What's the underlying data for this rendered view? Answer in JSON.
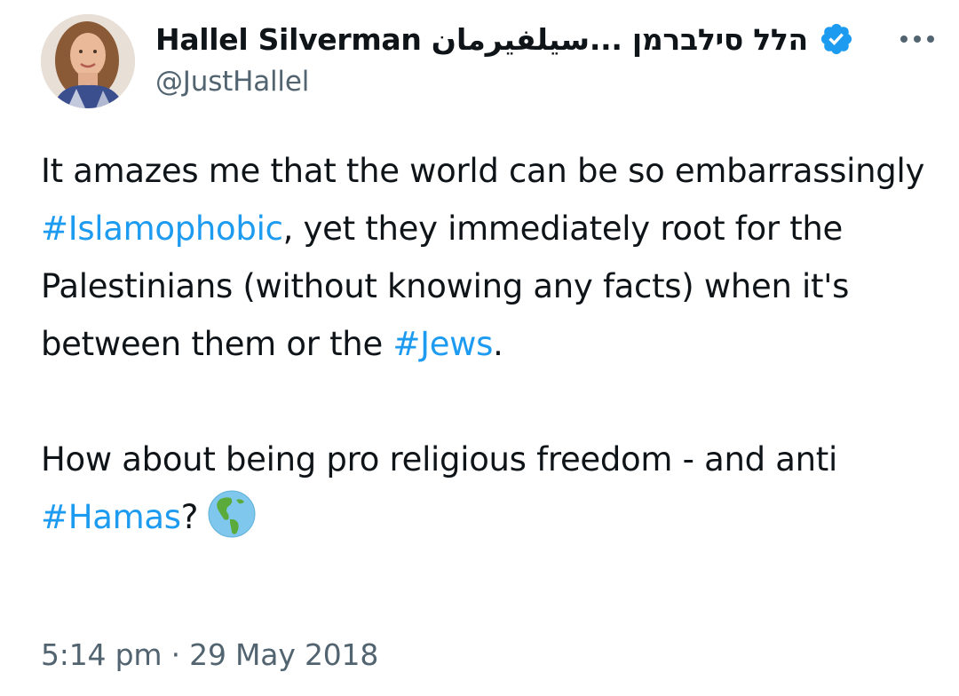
{
  "author": {
    "display_name": "Hallel Silverman הלל סילברמן ...سيلفيرمان",
    "handle": "@JustHallel",
    "verified": true
  },
  "colors": {
    "text": "#0f1419",
    "secondary": "#536471",
    "hashtag": "#1d9bf0",
    "verified": "#1d9bf0"
  },
  "tweet": {
    "p1": {
      "t1": "It amazes me that the world can be so embarrassingly ",
      "h1": "#Islamophobic",
      "t2": ", yet they immediately root for the Palestinians (without knowing any facts) when it's between them or the ",
      "h2": "#Jews",
      "t3": "."
    },
    "p2": {
      "t1": "How about being pro religious freedom - and anti ",
      "h1": "#Hamas",
      "t2": "?"
    },
    "emoji": "globe-americas-icon"
  },
  "timestamp": "5:14 pm · 29 May 2018",
  "menu_icon": "more-horizontal-icon"
}
